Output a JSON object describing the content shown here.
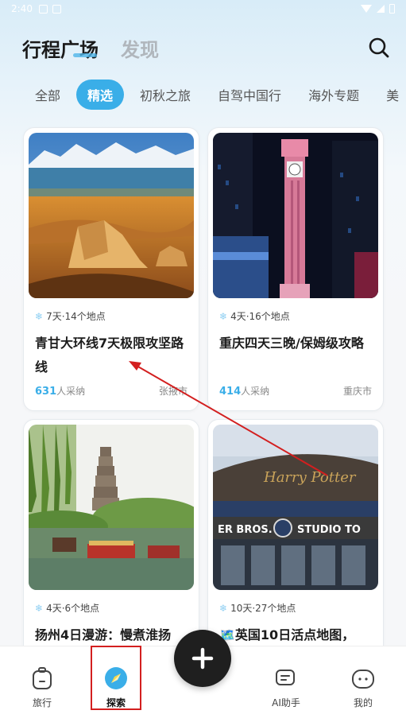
{
  "status_bar": {
    "time": "2:40"
  },
  "header": {
    "tab_active": "行程广场",
    "tab_inactive": "发现"
  },
  "tabs": [
    {
      "label": "全部",
      "active": false
    },
    {
      "label": "精选",
      "active": true
    },
    {
      "label": "初秋之旅",
      "active": false
    },
    {
      "label": "自驾中国行",
      "active": false
    },
    {
      "label": "海外专题",
      "active": false
    },
    {
      "label": "美",
      "active": false
    }
  ],
  "cards": [
    {
      "meta": "7天·14个地点",
      "title": "青甘大环线7天极限攻坚路线",
      "adopt_num": "631",
      "adopt_suffix": "人采纳",
      "city": "张掖市",
      "image": "qinghai-desert-lake"
    },
    {
      "meta": "4天·16个地点",
      "title": "重庆四天三晚/保姆级攻略",
      "adopt_num": "414",
      "adopt_suffix": "人采纳",
      "city": "重庆市",
      "image": "chongqing-clock-tower-night"
    },
    {
      "meta": "4天·6个地点",
      "title": "扬州4日漫游：慢煮淮扬",
      "image": "yangzhou-pagoda-lake"
    },
    {
      "meta": "10天·27个地点",
      "title": "英国10日活点地图，",
      "title_prefix": "🗺️",
      "image": "warner-bros-studio"
    }
  ],
  "bottom_nav": {
    "items": [
      {
        "label": "旅行",
        "icon": "suitcase-icon",
        "active": false
      },
      {
        "label": "探索",
        "icon": "compass-icon",
        "active": true
      },
      {
        "label": "AI助手",
        "icon": "chat-bubble-icon",
        "active": false
      },
      {
        "label": "我的",
        "icon": "profile-face-icon",
        "active": false
      }
    ]
  },
  "colors": {
    "accent": "#3aaee8",
    "annotation": "#d31f1f"
  }
}
